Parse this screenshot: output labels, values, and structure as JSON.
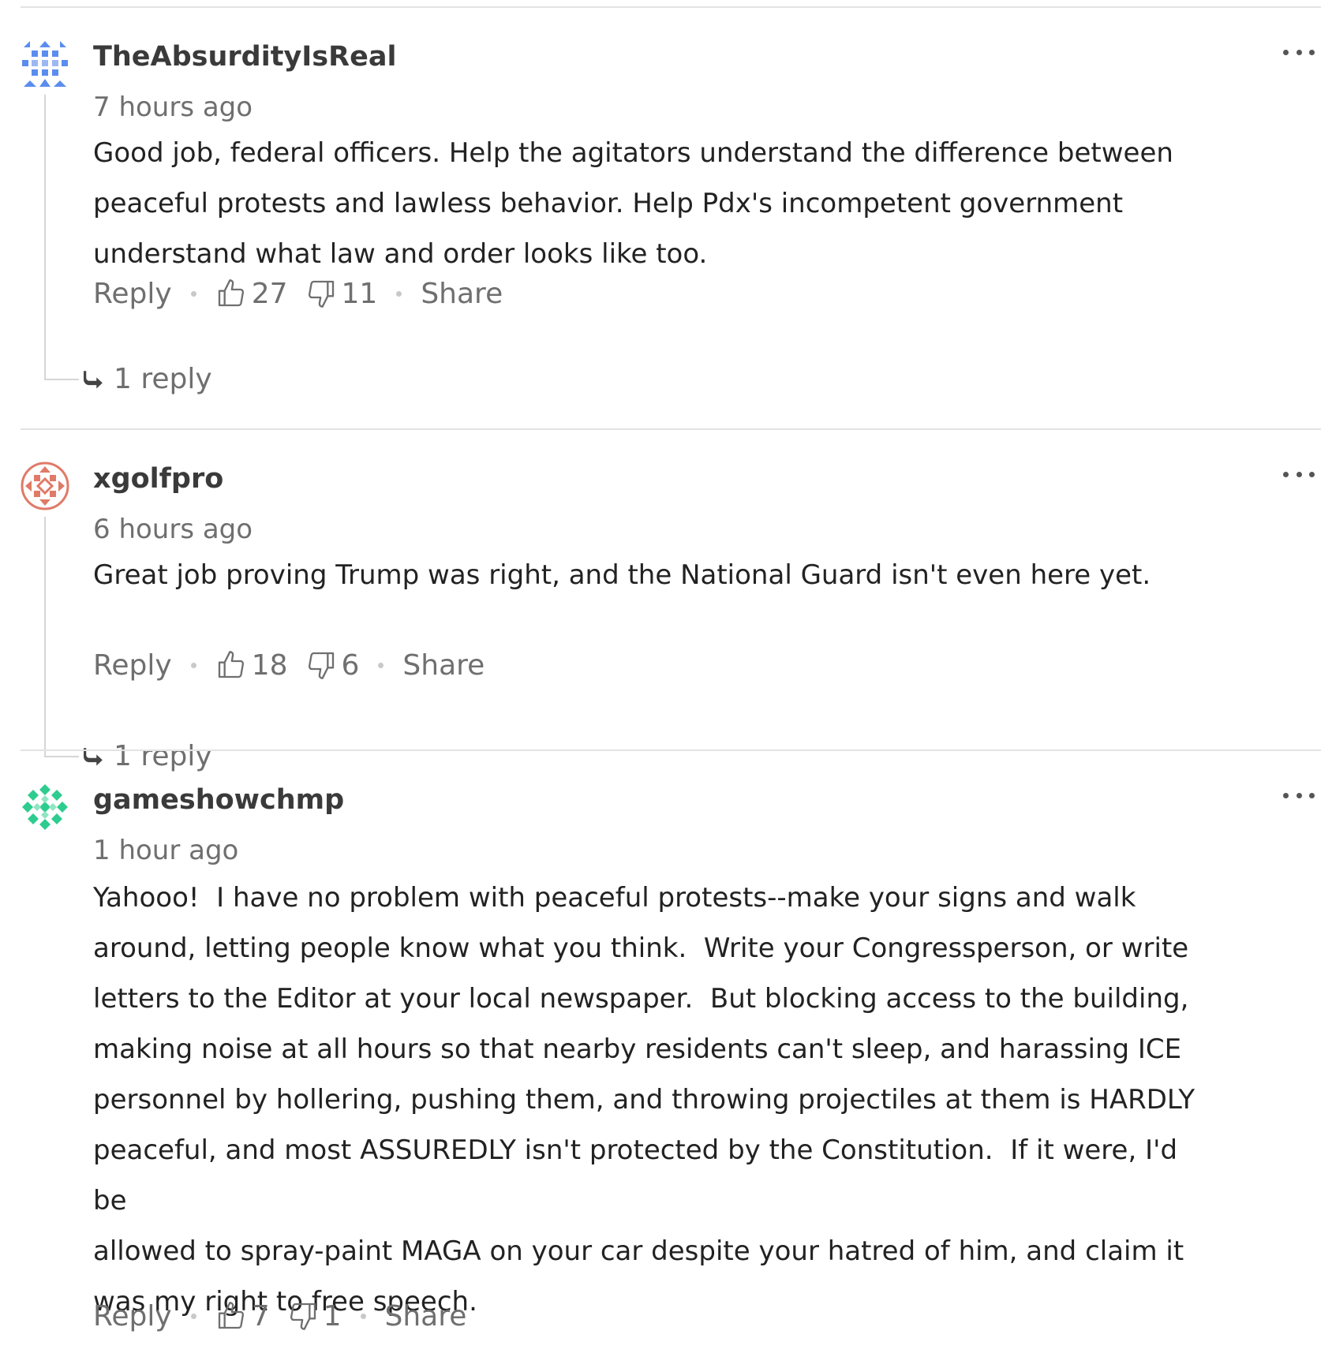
{
  "comments": [
    {
      "username": "TheAbsurdityIsReal",
      "time": "7 hours ago",
      "body": "Good job, federal officers. Help the agitators understand the difference between\npeaceful protests and lawless behavior. Help Pdx's incompetent government\nunderstand what law and order looks like too.",
      "reply_label": "Reply",
      "likes": "27",
      "dislikes": "11",
      "share_label": "Share",
      "replies_label": "1 reply",
      "avatar_color": "#5b8def"
    },
    {
      "username": "xgolfpro",
      "time": "6 hours ago",
      "body": "Great job proving Trump was right, and the National Guard isn't even here yet.",
      "reply_label": "Reply",
      "likes": "18",
      "dislikes": "6",
      "share_label": "Share",
      "replies_label": "1 reply",
      "avatar_color": "#e07a67"
    },
    {
      "username": "gameshowchmp",
      "time": "1 hour ago",
      "body": "Yahooo!  I have no problem with peaceful protests--make your signs and walk\naround, letting people know what you think.  Write your Congressperson, or write\nletters to the Editor at your local newspaper.  But blocking access to the building,\nmaking noise at all hours so that nearby residents can't sleep, and harassing ICE\npersonnel by hollering, pushing them, and throwing projectiles at them is HARDLY\npeaceful, and most ASSUREDLY isn't protected by the Constitution.  If it were, I'd be\nallowed to spray-paint MAGA on your car despite your hatred of him, and claim it\nwas my right to free speech.",
      "reply_label": "Reply",
      "likes": "7",
      "dislikes": "1",
      "share_label": "Share",
      "avatar_color": "#2ecc8f"
    }
  ],
  "icons": {
    "upvote": "thumbs-up-icon",
    "downvote": "thumbs-down-icon",
    "more": "more-options-icon",
    "reply_arrow": "reply-arrow-icon"
  }
}
